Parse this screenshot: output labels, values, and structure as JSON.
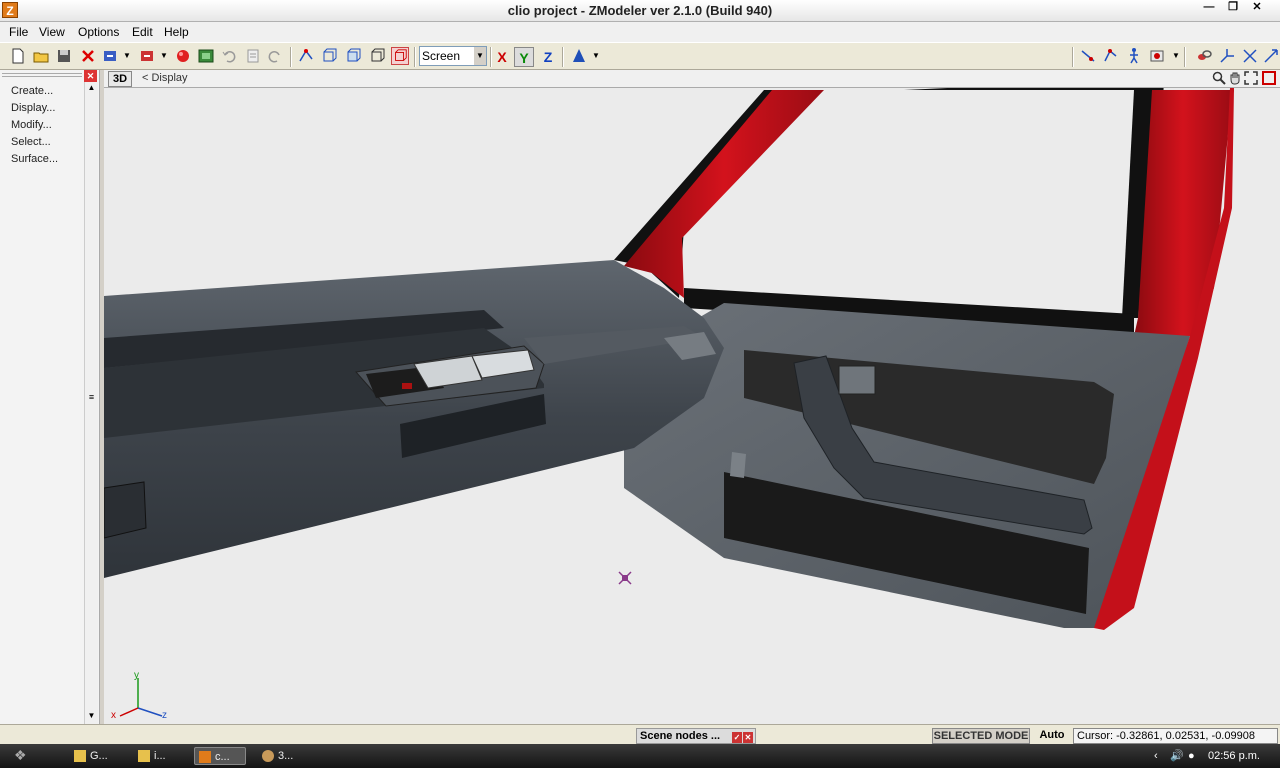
{
  "window": {
    "title": "clio project - ZModeler ver 2.1.0 (Build 940)",
    "app_icon_letter": "Z"
  },
  "menu": [
    "File",
    "View",
    "Options",
    "Edit",
    "Help"
  ],
  "toolbar": {
    "screen_select": "Screen",
    "axis_x": "X",
    "axis_y": "Y",
    "axis_z": "Z"
  },
  "left_panel": {
    "items": [
      "Create...",
      "Display...",
      "Modify...",
      "Select...",
      "Surface..."
    ]
  },
  "viewport": {
    "mode": "3D",
    "breadcrumb": "< Display",
    "gizmo": {
      "x": "x",
      "y": "y",
      "z": "z"
    }
  },
  "status": {
    "scene_tab": "Scene nodes ...",
    "mode": "SELECTED MODE",
    "auto": "Auto",
    "cursor": "Cursor: -0.32861, 0.02531, -0.09908"
  },
  "taskbar": {
    "items": [
      "G...",
      "i...",
      "c...",
      "3..."
    ],
    "clock": "02:56 p.m."
  },
  "colors": {
    "car_red": "#c4101a",
    "dashboard": "#4a5058",
    "door_panel": "#5a6068",
    "viewport_bg": "#ebebeb"
  }
}
